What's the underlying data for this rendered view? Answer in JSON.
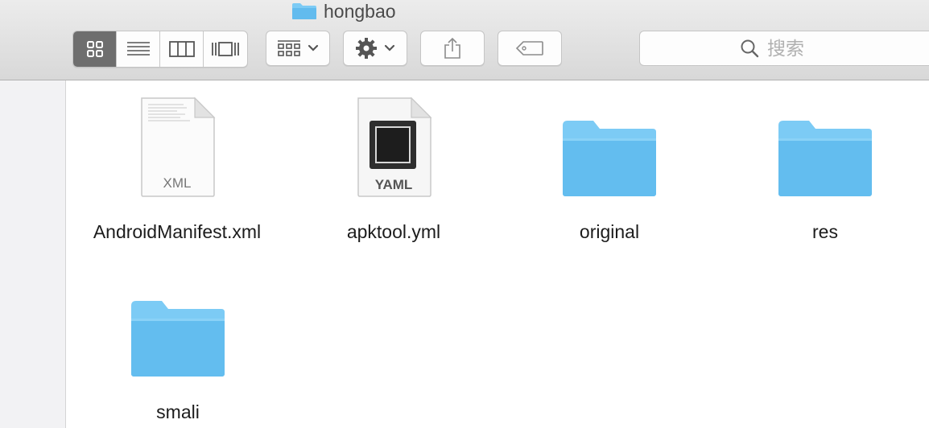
{
  "window": {
    "title": "hongbao"
  },
  "toolbar": {
    "view_modes": [
      {
        "name": "icon-view",
        "active": true
      },
      {
        "name": "list-view",
        "active": false
      },
      {
        "name": "column-view",
        "active": false
      },
      {
        "name": "coverflow-view",
        "active": false
      }
    ],
    "arrange_icon": "arrange-grid-icon",
    "action_icon": "gear-icon",
    "share_icon": "share-icon",
    "tag_icon": "tag-icon",
    "search": {
      "placeholder": "搜索",
      "value": ""
    }
  },
  "files": [
    {
      "name": "AndroidManifest.xml",
      "kind": "xml-file",
      "badge": "XML"
    },
    {
      "name": "apktool.yml",
      "kind": "yaml-file",
      "badge": "YAML"
    },
    {
      "name": "original",
      "kind": "folder"
    },
    {
      "name": "res",
      "kind": "folder"
    },
    {
      "name": "smali",
      "kind": "folder"
    }
  ],
  "colors": {
    "folder": "#6ec4f1",
    "selected_view": "#6e6e6e"
  }
}
